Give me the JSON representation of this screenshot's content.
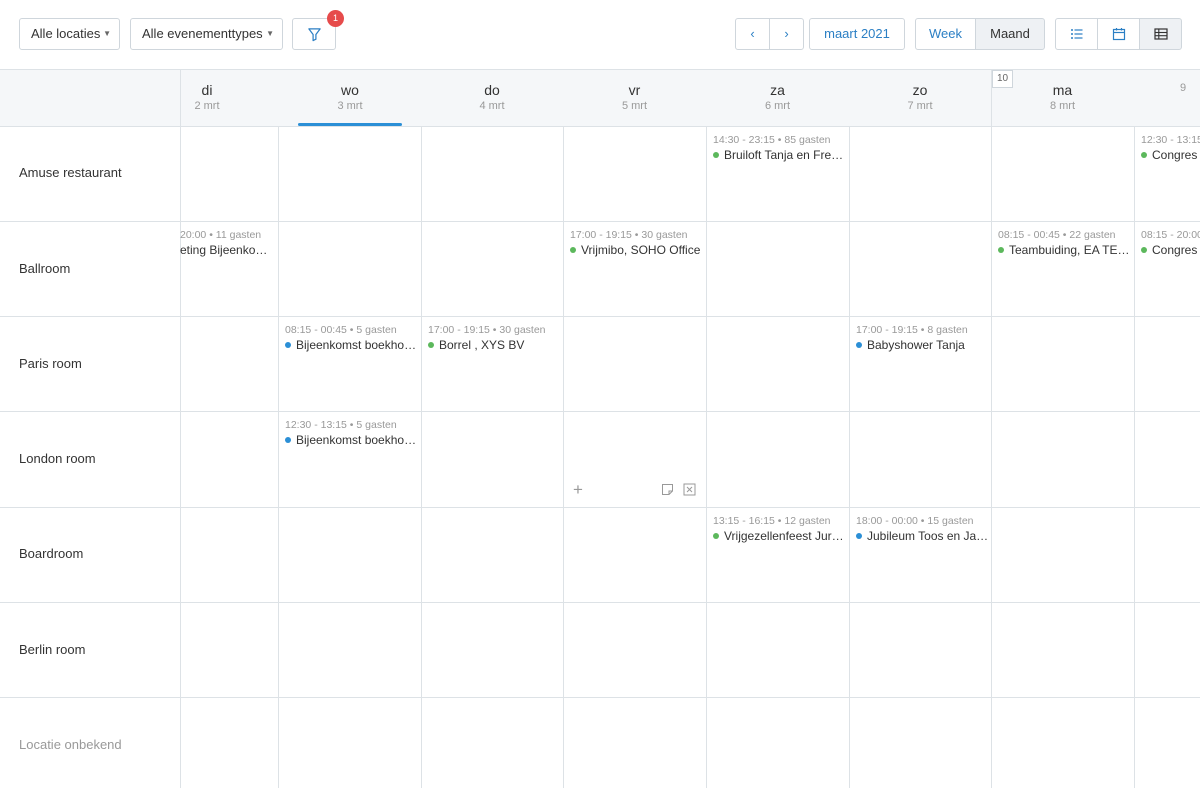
{
  "toolbar": {
    "location_select": "Alle locaties",
    "type_select": "Alle evenementtypes",
    "filter_badge": "1",
    "prev_label": "‹",
    "next_label": "›",
    "month_label": "maart 2021",
    "week_label": "Week",
    "month_view_label": "Maand"
  },
  "week_number": "10",
  "days": [
    {
      "name": "di",
      "date": "2 mrt"
    },
    {
      "name": "wo",
      "date": "3 mrt"
    },
    {
      "name": "do",
      "date": "4 mrt"
    },
    {
      "name": "vr",
      "date": "5 mrt"
    },
    {
      "name": "za",
      "date": "6 mrt"
    },
    {
      "name": "zo",
      "date": "7 mrt"
    },
    {
      "name": "ma",
      "date": "8 mrt"
    },
    {
      "name": "",
      "date": "9"
    }
  ],
  "locations": [
    "Amuse restaurant",
    "Ballroom",
    "Paris room",
    "London room",
    "Boardroom",
    "Berlin room",
    "Locatie onbekend"
  ],
  "events": [
    {
      "meta": "14:30 - 23:15 • 85 gasten",
      "title": "Bruiloft Tanja en Fre…",
      "color": "#5cb85c"
    },
    {
      "meta": "12:30 - 13:15",
      "title": "Congres",
      "color": "#5cb85c"
    },
    {
      "meta": "20:00 • 11 gasten",
      "title": "eting Bijeenko…",
      "color": "#5cb85c"
    },
    {
      "meta": "17:00 - 19:15 • 30 gasten",
      "title": "Vrijmibo, SOHO Office",
      "color": "#5cb85c"
    },
    {
      "meta": "08:15 - 00:45 • 22 gasten",
      "title": "Teambuiding, EA TE…",
      "color": "#5cb85c"
    },
    {
      "meta": "08:15 - 20:00",
      "title": "Congres",
      "color": "#5cb85c"
    },
    {
      "meta": "08:15 - 00:45 • 5 gasten",
      "title": "Bijeenkomst boekho…",
      "color": "#2b8fd6"
    },
    {
      "meta": "17:00 - 19:15 • 30 gasten",
      "title": "Borrel , XYS BV",
      "color": "#5cb85c"
    },
    {
      "meta": "17:00 - 19:15 • 8 gasten",
      "title": "Babyshower Tanja",
      "color": "#2b8fd6"
    },
    {
      "meta": "12:30 - 13:15 • 5 gasten",
      "title": "Bijeenkomst boekho…",
      "color": "#2b8fd6"
    },
    {
      "meta": "13:15 - 16:15 • 12 gasten",
      "title": "Vrijgezellenfeest Jur…",
      "color": "#5cb85c"
    },
    {
      "meta": "18:00 - 00:00 • 15 gasten",
      "title": "Jubileum Toos en Ja…",
      "color": "#2b8fd6"
    }
  ],
  "cell_actions": {
    "add": "+"
  }
}
